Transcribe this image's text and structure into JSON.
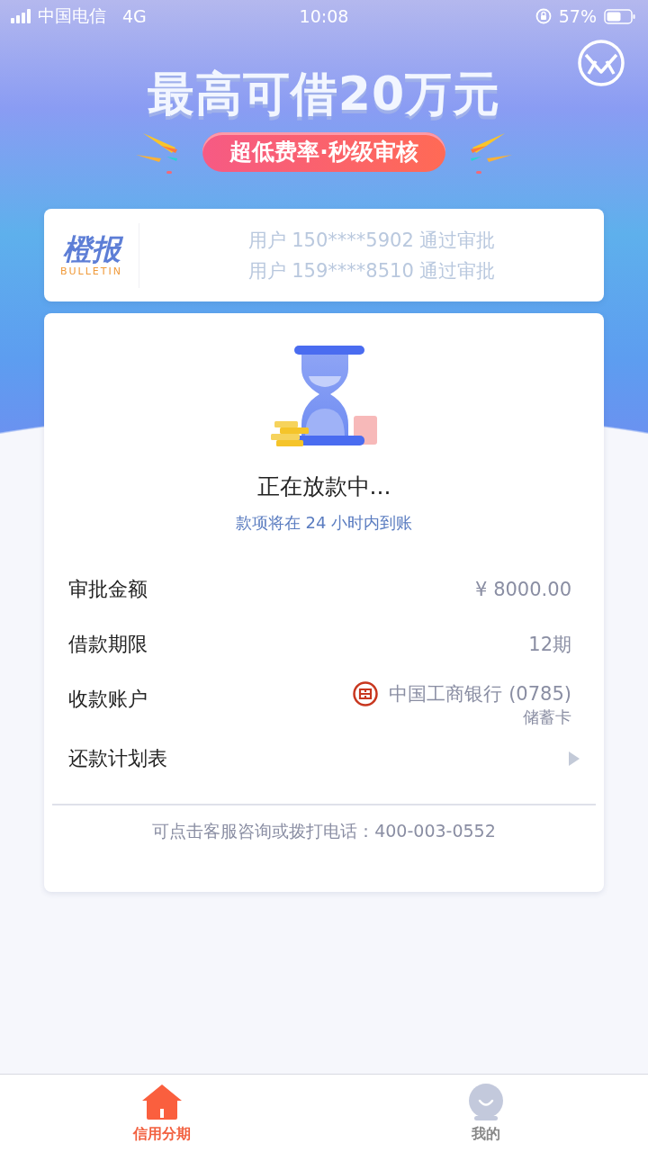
{
  "status_bar": {
    "carrier": "中国电信",
    "network": "4G",
    "time": "10:08",
    "battery": "57%"
  },
  "banner": {
    "headline": "最高可借20万元",
    "tagline": "超低费率·秒级审核"
  },
  "bulletin": {
    "logo_text": "橙报",
    "logo_subtitle": "BULLETIN",
    "messages": [
      "用户 150****5902 通过审批",
      "用户 159****8510 通过审批"
    ]
  },
  "status": {
    "title": "正在放款中...",
    "subtitle": "款项将在 24 小时内到账"
  },
  "details": [
    {
      "kind": "text",
      "label": "审批金额",
      "value": "¥ 8000.00"
    },
    {
      "kind": "text",
      "label": "借款期限",
      "value": "12期"
    },
    {
      "kind": "bank",
      "label": "收款账户",
      "value": "中国工商银行 (0785)",
      "note": "储蓄卡"
    },
    {
      "kind": "link",
      "label": "还款计划表"
    }
  ],
  "footer_note": "可点击客服咨询或拨打电话：400-003-0552",
  "tabs": [
    {
      "kind": "home",
      "label": "信用分期",
      "selected": true
    },
    {
      "kind": "profile",
      "label": "我的",
      "selected": false
    }
  ]
}
